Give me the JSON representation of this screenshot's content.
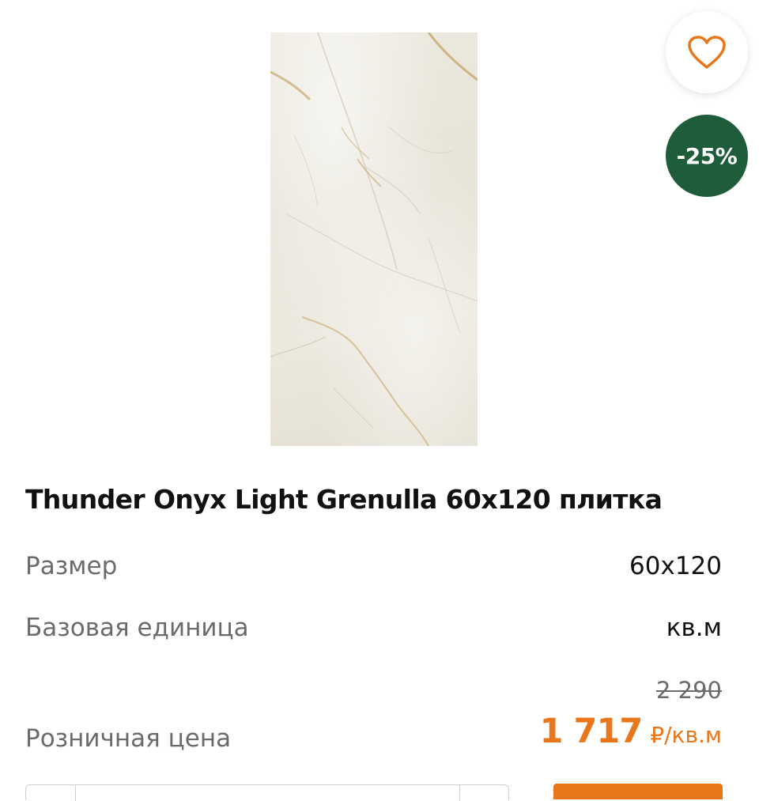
{
  "product": {
    "title": "Thunder Onyx Light Grenulla 60x120 плитка",
    "image_icon": "marble-tile-image",
    "discount_badge": "-25%",
    "favorite_icon": "heart-outline-icon"
  },
  "specs": [
    {
      "label": "Размер",
      "value": "60x120"
    },
    {
      "label": "Базовая единица",
      "value": "кв.м"
    }
  ],
  "price": {
    "label": "Розничная цена",
    "old_price": "2 290",
    "current_price": "1 717",
    "unit": "₽/кв.м"
  },
  "colors": {
    "accent": "#e8761a",
    "badge": "#1f5c3a",
    "text": "#111111",
    "muted": "#6b6b6b"
  }
}
